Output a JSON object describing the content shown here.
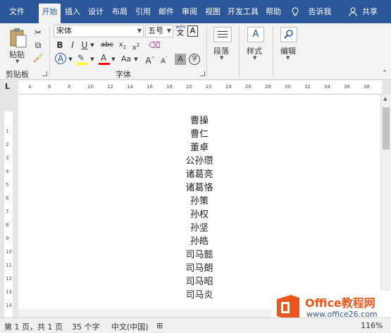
{
  "tabs": [
    {
      "label": "文件"
    },
    {
      "label": "开始"
    },
    {
      "label": "插入"
    },
    {
      "label": "设计"
    },
    {
      "label": "布局"
    },
    {
      "label": "引用"
    },
    {
      "label": "邮件"
    },
    {
      "label": "审阅"
    },
    {
      "label": "视图"
    },
    {
      "label": "开发工具"
    },
    {
      "label": "帮助"
    },
    {
      "label": "告诉我"
    },
    {
      "label": "共享"
    }
  ],
  "ribbon": {
    "clipboard": {
      "paste": "粘贴",
      "group": "剪贴板"
    },
    "font": {
      "name": "宋体",
      "size": "五号",
      "group": "字体",
      "wen": "wén",
      "wen_char": "文",
      "A_box": "A"
    },
    "paragraph": "段落",
    "styles": "样式",
    "editing": "编辑"
  },
  "ruler": {
    "corner": "L",
    "h_ticks": [
      "4",
      "6",
      "8",
      "10",
      "12",
      "14",
      "16",
      "18",
      "20",
      "22",
      "24",
      "26",
      "28",
      "30",
      "32",
      "34",
      "36",
      "38"
    ],
    "v_ticks": [
      "1",
      "2",
      "3",
      "4",
      "5",
      "6",
      "7",
      "8",
      "9",
      "10",
      "11",
      "12",
      "13",
      "14"
    ]
  },
  "document": {
    "lines": [
      "曹操",
      "曹仁",
      "董卓",
      "公孙瓒",
      "诸葛亮",
      "诸葛恪",
      "孙策",
      "孙权",
      "孙坚",
      "孙皓",
      "司马懿",
      "司马朗",
      "司马昭",
      "司马炎"
    ]
  },
  "status": {
    "page": "第 1 页，共 1 页",
    "words": "35 个字",
    "lang": "中文(中国)",
    "zoom": "116%"
  },
  "watermark": {
    "brand": "Office教程网",
    "url": "www.office26.com"
  },
  "colors": {
    "brand": "#2b579a",
    "highlight": "#ffff00",
    "font_color": "#ff0000",
    "logo_orange": "#e8571e"
  }
}
